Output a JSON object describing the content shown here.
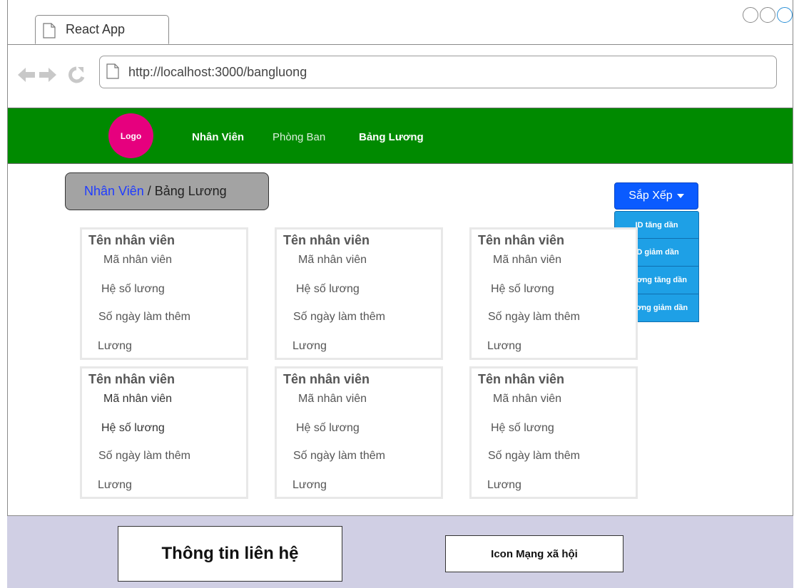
{
  "browser": {
    "tab_title": "React App",
    "url": "http://localhost:3000/bangluong"
  },
  "header": {
    "logo": "Logo",
    "nav": [
      "Nhân Viên",
      "Phòng Ban",
      "Bảng Lương"
    ],
    "bg_color": "#008a00",
    "logo_color": "#e6007e"
  },
  "breadcrumb": {
    "link": "Nhân Viên",
    "separator": " / ",
    "current": "Bảng Lương"
  },
  "sort": {
    "label": "Sắp Xếp",
    "options": [
      "ID tăng dần",
      "ID giảm dần",
      "Lương tăng dần",
      "Lương giảm dần"
    ]
  },
  "cards": [
    {
      "name": "Tên nhân viên",
      "id": "Mã nhân viên",
      "coef": "Hệ số lương",
      "overtime": "Số ngày làm thêm",
      "salary": "Lương"
    },
    {
      "name": "Tên nhân viên",
      "id": "Mã nhân viên",
      "coef": "Hệ số lương",
      "overtime": "Số ngày làm thêm",
      "salary": "Lương"
    },
    {
      "name": "Tên nhân viên",
      "id": "Mã nhân viên",
      "coef": "Hệ số lương",
      "overtime": "Số ngày làm thêm",
      "salary": "Lương"
    },
    {
      "name": "Tên nhân viên",
      "id": "Mã nhân viên",
      "coef": "Hệ số lương",
      "overtime": "Số ngày làm thêm",
      "salary": "Lương"
    },
    {
      "name": "Tên nhân viên",
      "id": "Mã nhân viên",
      "coef": "Hệ số lương",
      "overtime": "Số ngày làm thêm",
      "salary": "Lương"
    },
    {
      "name": "Tên nhân viên",
      "id": "Mã nhân viên",
      "coef": "Hệ số lương",
      "overtime": "Số ngày làm thêm",
      "salary": "Lương"
    }
  ],
  "footer": {
    "contact": "Thông tin liên hệ",
    "social": "Icon Mạng xã hội",
    "bg_color": "#d0cfe4"
  }
}
